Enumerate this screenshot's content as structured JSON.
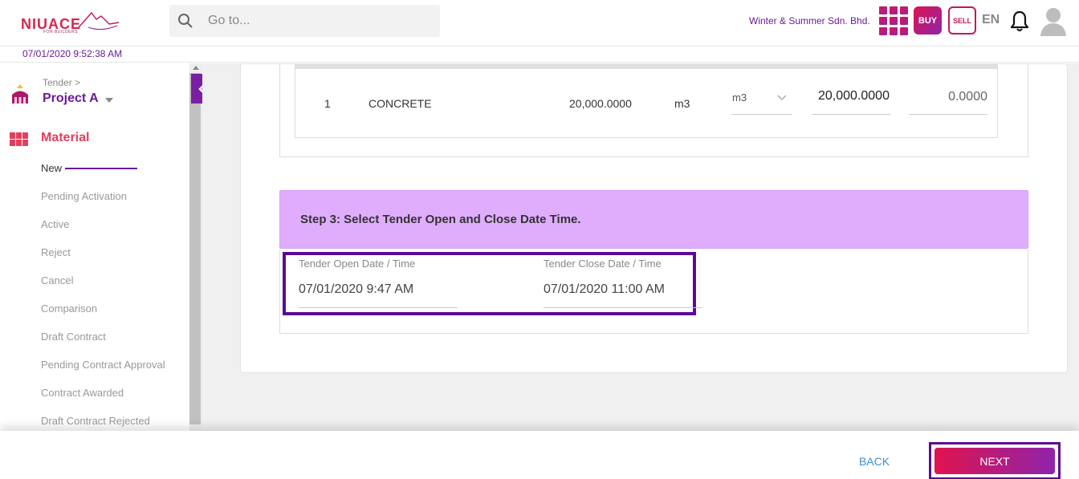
{
  "header": {
    "logo_text": "NIUACE",
    "logo_sub": "FOR BUILDERS",
    "search_placeholder": "Go to...",
    "company": "Winter & Summer Sdn. Bhd.",
    "buy_label": "BUY",
    "sell_label": "SELL",
    "language": "EN",
    "datetime": "07/01/2020 9:52:38 AM"
  },
  "sidebar": {
    "breadcrumb": "Tender >",
    "project": "Project A",
    "section_title": "Material",
    "items": [
      {
        "label": "New",
        "active": true
      },
      {
        "label": "Pending Activation"
      },
      {
        "label": "Active"
      },
      {
        "label": "Reject"
      },
      {
        "label": "Cancel"
      },
      {
        "label": "Comparison"
      },
      {
        "label": "Draft Contract"
      },
      {
        "label": "Pending Contract Approval"
      },
      {
        "label": "Contract Awarded"
      },
      {
        "label": "Draft Contract Rejected"
      }
    ]
  },
  "material_row": {
    "no": "1",
    "name": "CONCRETE",
    "quantity": "20,000.0000",
    "unit": "m3",
    "uom_selected": "m3",
    "quantity_input": "20,000.0000",
    "price_input": "0.0000"
  },
  "step3": {
    "title": "Step 3: Select Tender Open and Close Date Time.",
    "open_label": "Tender Open Date / Time",
    "open_value": "07/01/2020 9:47 AM",
    "close_label": "Tender Close Date / Time",
    "close_value": "07/01/2020 11:00 AM"
  },
  "footer": {
    "back_label": "BACK",
    "next_label": "NEXT"
  },
  "colors": {
    "brand": "#6a1b9a",
    "accent": "#e0134f",
    "step_header": "#dfadfc",
    "highlight": "#5b0a96"
  }
}
